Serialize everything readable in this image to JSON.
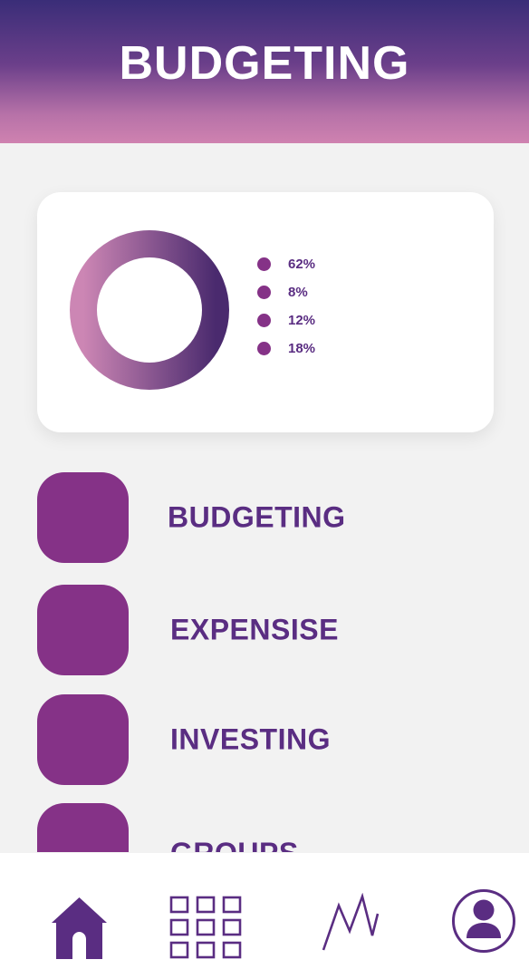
{
  "header": {
    "title": "BUDGETING"
  },
  "colors": {
    "header_top": "#3a2d78",
    "header_bottom": "#cf82b0",
    "accent": "#853287",
    "text_primary": "#5a2d82",
    "background": "#f2f2f2",
    "card": "#ffffff"
  },
  "chart_data": {
    "type": "pie",
    "title": "",
    "values": [
      62,
      8,
      12,
      18
    ],
    "labels": [
      "62%",
      "8%",
      "12%",
      "18%"
    ],
    "legend_placement": "right",
    "donut": true
  },
  "menu": {
    "items": [
      {
        "label": "BUDGETING"
      },
      {
        "label": "EXPENSISE"
      },
      {
        "label": "INVESTING"
      },
      {
        "label": "GROUPS"
      }
    ]
  },
  "bottom_nav": {
    "items": [
      {
        "icon": "home-icon",
        "active": true
      },
      {
        "icon": "grid-icon",
        "active": false
      },
      {
        "icon": "chart-line-icon",
        "active": false
      },
      {
        "icon": "user-profile-icon",
        "active": false
      }
    ]
  }
}
